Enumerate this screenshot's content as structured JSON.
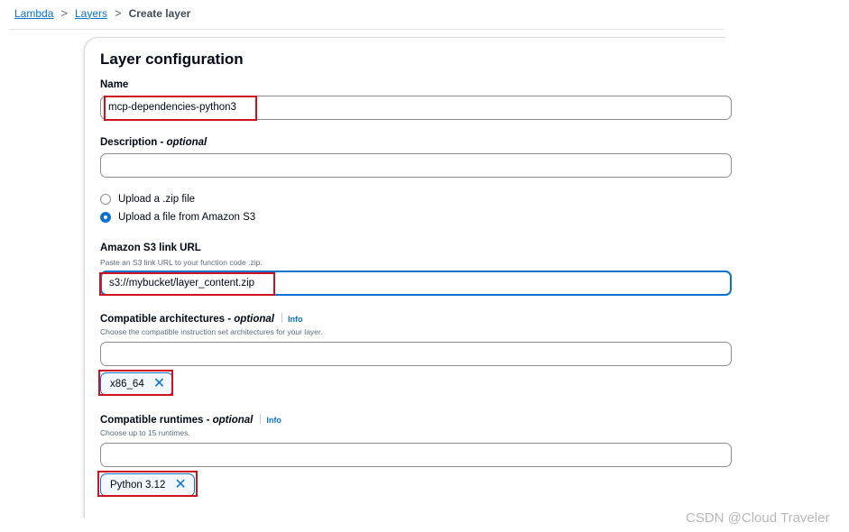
{
  "breadcrumb": {
    "items": [
      "Lambda",
      "Layers"
    ],
    "current": "Create layer",
    "separator": ">"
  },
  "panel": {
    "title": "Layer configuration"
  },
  "name_field": {
    "label": "Name",
    "value": "mcp-dependencies-python3"
  },
  "description_field": {
    "label": "Description",
    "optional": "optional",
    "dash": " - ",
    "value": ""
  },
  "upload_options": {
    "zip_label": "Upload a .zip file",
    "s3_label": "Upload a file from Amazon S3",
    "selected": "s3"
  },
  "s3_field": {
    "label": "Amazon S3 link URL",
    "hint": "Paste an S3 link URL to your function code .zip.",
    "value": "s3://mybucket/layer_content.zip"
  },
  "architectures": {
    "label": "Compatible architectures",
    "optional": "optional",
    "dash": " - ",
    "info": "Info",
    "hint": "Choose the compatible instruction set architectures for your layer.",
    "value": "",
    "selected_token": "x86_64",
    "remove_glyph": "✕"
  },
  "runtimes": {
    "label": "Compatible runtimes",
    "optional": "optional",
    "dash": " - ",
    "info": "Info",
    "hint": "Choose up to 15 runtimes.",
    "value": "",
    "selected_token": "Python 3.12",
    "remove_glyph": "✕"
  },
  "watermark": "CSDN @Cloud Traveler",
  "colors": {
    "accent": "#0972d3",
    "highlight": "#d0121e"
  }
}
